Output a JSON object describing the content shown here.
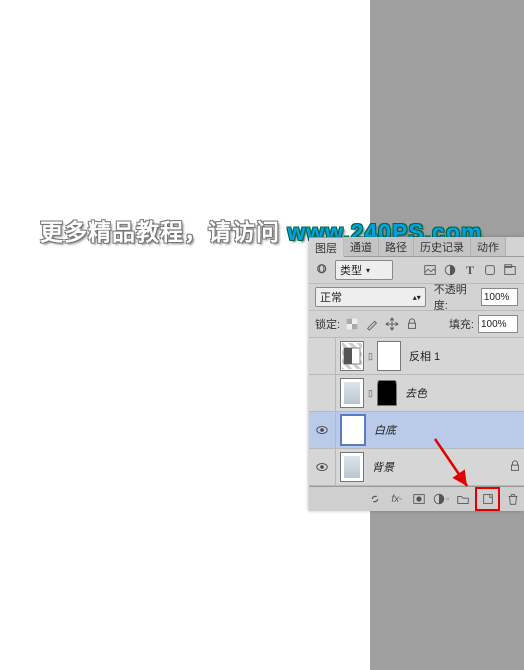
{
  "watermark": {
    "part1": "更多精品教程，请访问 ",
    "part2": "www.240PS.com"
  },
  "tabs": {
    "layers": "图层",
    "channels": "通道",
    "paths": "路径",
    "history": "历史记录",
    "actions": "动作"
  },
  "pickers": {
    "kind": "类型",
    "blend": "正常"
  },
  "labels": {
    "opacity": "不透明度:",
    "fill": "填充:",
    "lock": "锁定:"
  },
  "values": {
    "opacity": "100%",
    "fill": "100%"
  },
  "layers": [
    {
      "name": "反相 1",
      "eye": ""
    },
    {
      "name": "去色",
      "eye": ""
    },
    {
      "name": "白底",
      "eye": "●"
    },
    {
      "name": "背景",
      "eye": "●"
    }
  ],
  "icons": {
    "search": "search-icon",
    "image": "image-icon",
    "adjust": "adjust-icon",
    "type": "type-icon",
    "shape": "shape-icon",
    "smart": "smart-icon",
    "lock_trans": "lock-transparency-icon",
    "lock_paint": "lock-paint-icon",
    "lock_pos": "lock-position-icon",
    "lock_all": "lock-all-icon",
    "eye": "eye-icon",
    "link": "link-icon",
    "fx": "fx-icon",
    "mask": "mask-icon",
    "adjlayer": "adjustment-layer-icon",
    "group": "group-icon",
    "newlayer": "new-layer-icon",
    "trash": "trash-icon"
  }
}
